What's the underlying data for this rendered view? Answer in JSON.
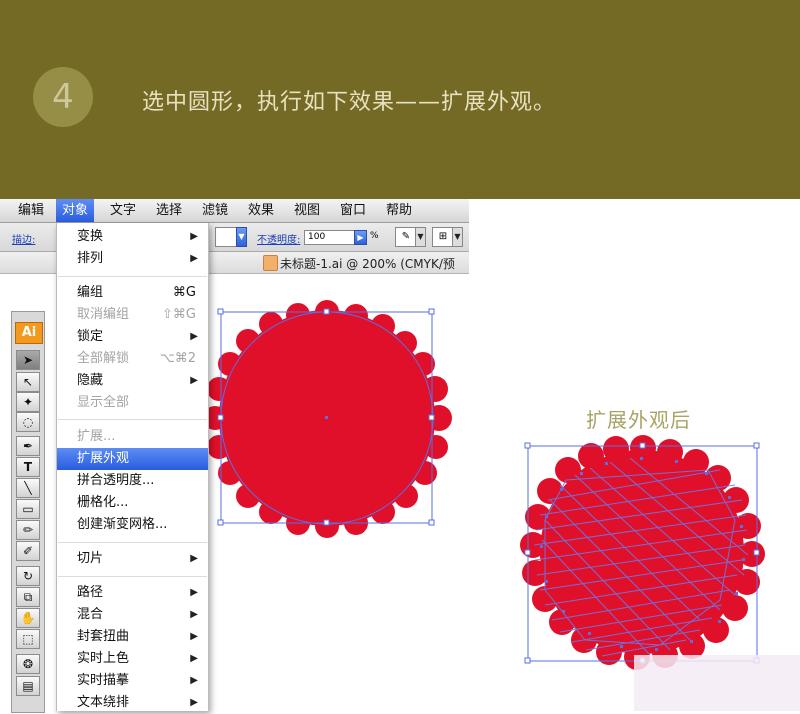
{
  "banner": {
    "step_number": "4",
    "instruction": "选中圆形，执行如下效果——扩展外观。",
    "bg_color": "#746a25"
  },
  "menubar": {
    "items": [
      "编辑",
      "对象",
      "文字",
      "选择",
      "滤镜",
      "效果",
      "视图",
      "窗口",
      "帮助"
    ],
    "active": "对象"
  },
  "toolbar": {
    "stroke_label": "描边:",
    "opacity_label": "不透明度:",
    "opacity_value": "100",
    "percent": "%"
  },
  "document": {
    "title": "未标题-1.ai @ 200% (CMYK/预"
  },
  "tools_panel": {
    "logo": "Ai"
  },
  "object_menu": {
    "items": [
      {
        "label": "变换",
        "arrow": "▶"
      },
      {
        "label": "排列",
        "arrow": "▶"
      },
      {
        "label": "编组",
        "shortcut": "⌘G"
      },
      {
        "label": "取消编组",
        "shortcut": "⇧⌘G",
        "disabled": true
      },
      {
        "label": "锁定",
        "arrow": "▶"
      },
      {
        "label": "全部解锁",
        "shortcut": "⌥⌘2",
        "disabled": true
      },
      {
        "label": "隐藏",
        "arrow": "▶"
      },
      {
        "label": "显示全部",
        "disabled": true
      },
      {
        "label": "扩展...",
        "disabled": true
      },
      {
        "label": "扩展外观",
        "highlighted": true
      },
      {
        "label": "拼合透明度..."
      },
      {
        "label": "栅格化..."
      },
      {
        "label": "创建渐变网格..."
      },
      {
        "label": "切片",
        "arrow": "▶"
      },
      {
        "label": "路径",
        "arrow": "▶"
      },
      {
        "label": "混合",
        "arrow": "▶"
      },
      {
        "label": "封套扭曲",
        "arrow": "▶"
      },
      {
        "label": "实时上色",
        "arrow": "▶"
      },
      {
        "label": "实时描摹",
        "arrow": "▶"
      },
      {
        "label": "文本绕排",
        "arrow": "▶"
      }
    ]
  },
  "after_label": "扩展外观后",
  "colors": {
    "shape_red": "#e0102a",
    "path_blue": "#5a6fe6",
    "menu_highlight": "#2f62e2"
  }
}
